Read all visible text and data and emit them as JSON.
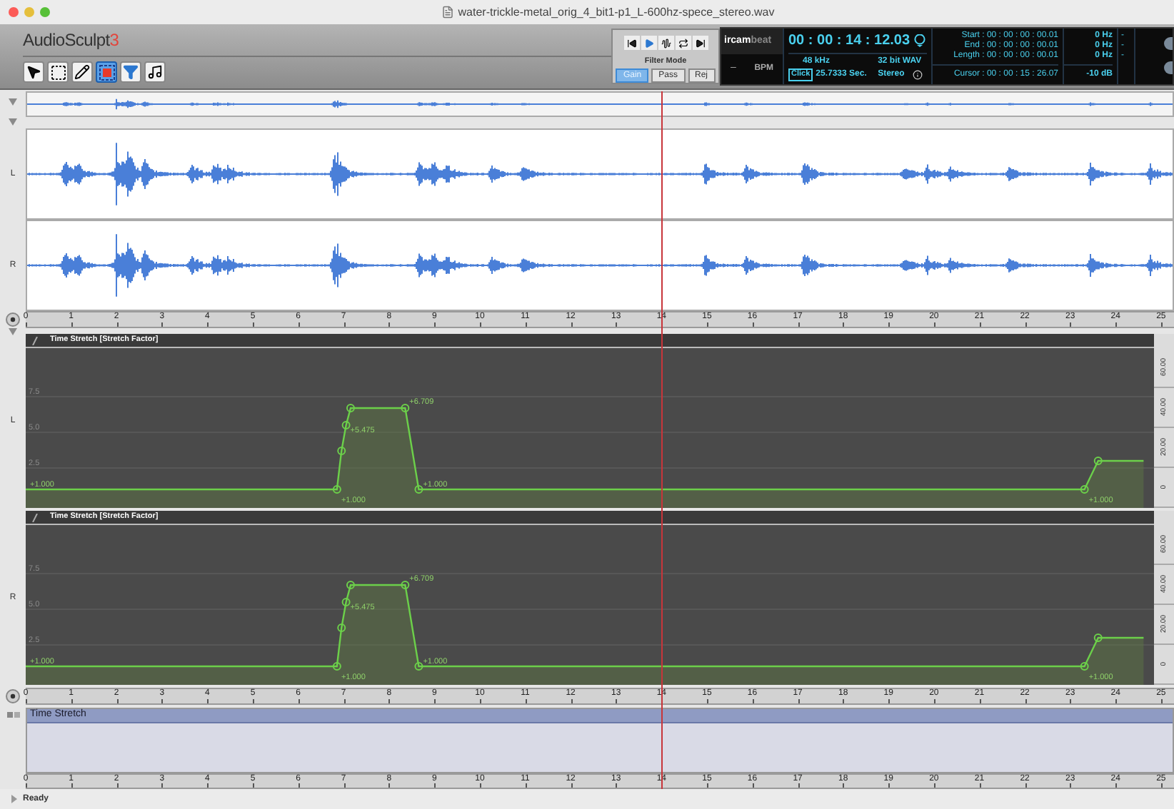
{
  "window": {
    "title": "water-trickle-metal_orig_4_bit1-p1_L-600hz-spece_stereo.wav"
  },
  "app": {
    "name": "AudioSculpt",
    "version": "3"
  },
  "tools": [
    {
      "kind": "pointer",
      "selected": false
    },
    {
      "kind": "marquee",
      "selected": false
    },
    {
      "kind": "pencil",
      "selected": false
    },
    {
      "kind": "region",
      "selected": true
    },
    {
      "kind": "filter",
      "selected": false
    },
    {
      "kind": "note",
      "selected": false
    }
  ],
  "filter": {
    "label": "Filter Mode",
    "modes": [
      {
        "label": "Gain",
        "selected": true
      },
      {
        "label": "Pass",
        "selected": false
      },
      {
        "label": "Rej",
        "selected": false
      }
    ]
  },
  "display": {
    "logo_main": "ircam",
    "logo_sub": "beat",
    "time": "00 : 00 : 14 : 12.03",
    "tempo_value": "–",
    "tempo_label": "BPM",
    "click": "Click",
    "sample_rate": "48 kHz",
    "format": "32 bit WAV",
    "duration": "25.7333 Sec.",
    "channels": "Stereo",
    "positions": [
      "Start : 00 : 00 : 00 : 00.01",
      "End : 00 : 00 : 00 : 00.01",
      "Length : 00 : 00 : 00 : 00.01"
    ],
    "cursor": "Cursor : 00 : 00 : 15 : 26.07",
    "frequencies": [
      "0 Hz",
      "0 Hz",
      "0 Hz"
    ],
    "level": "-10 dB",
    "dashes": [
      "-",
      "-",
      "-"
    ]
  },
  "waveform": {
    "channels": [
      "L",
      "R"
    ]
  },
  "automation": [
    {
      "channel": "L",
      "point_labels": [
        "+1.000",
        "+1.000",
        "+5.475",
        "+6.709",
        "+1.000",
        "+1.000"
      ],
      "scale": [
        "60.00",
        "40.00",
        "20.00",
        "0"
      ],
      "chart_data": {
        "type": "area",
        "title": "Time Stretch [Stretch Factor]",
        "x": [
          0,
          6.85,
          6.95,
          7.05,
          7.15,
          8.35,
          8.65,
          23.3,
          23.6,
          24.6
        ],
        "xlim": [
          0,
          25.27
        ],
        "ylim": [
          -0.3,
          10.9
        ],
        "grid": true,
        "xticks": [
          0,
          1,
          2,
          3,
          4,
          5,
          6,
          7,
          8,
          9,
          10,
          11,
          12,
          13,
          14,
          15,
          16,
          17,
          18,
          19,
          20,
          21,
          22,
          23,
          24,
          25
        ],
        "yticks": [
          {
            "value": 7.5,
            "label": "7.5"
          },
          {
            "value": 5,
            "label": "5.0"
          },
          {
            "value": 2.5,
            "label": "2.5"
          }
        ],
        "series": [
          {
            "color": "#6cd04a",
            "values": [
              1,
              1,
              3.7,
              5.5,
              6.7,
              6.7,
              1,
              1,
              3,
              3
            ]
          }
        ]
      }
    },
    {
      "channel": "R",
      "point_labels": [
        "+1.000",
        "+1.000",
        "+5.475",
        "+6.709",
        "+1.000",
        "+1.000"
      ],
      "scale": [
        "60.00",
        "40.00",
        "20.00",
        "0"
      ],
      "chart_data": {
        "type": "area",
        "title": "Time Stretch [Stretch Factor]",
        "x": [
          0,
          6.85,
          6.95,
          7.05,
          7.15,
          8.35,
          8.65,
          23.3,
          23.6,
          24.6
        ],
        "xlim": [
          0,
          25.27
        ],
        "ylim": [
          -0.3,
          10.9
        ],
        "grid": true,
        "xticks": [
          0,
          1,
          2,
          3,
          4,
          5,
          6,
          7,
          8,
          9,
          10,
          11,
          12,
          13,
          14,
          15,
          16,
          17,
          18,
          19,
          20,
          21,
          22,
          23,
          24,
          25
        ],
        "yticks": [
          {
            "value": 7.5,
            "label": "7.5"
          },
          {
            "value": 5,
            "label": "5.0"
          },
          {
            "value": 2.5,
            "label": "2.5"
          }
        ],
        "series": [
          {
            "color": "#6cd04a",
            "values": [
              1,
              1,
              3.7,
              5.5,
              6.7,
              6.7,
              1,
              1,
              3,
              3
            ]
          }
        ]
      }
    }
  ],
  "track": {
    "title": "Time Stretch",
    "ruler_ticks": [
      "0",
      "1",
      "2",
      "3",
      "4",
      "5",
      "6",
      "7",
      "8",
      "9",
      "10",
      "11",
      "12",
      "13",
      "14",
      "15",
      "16",
      "17",
      "18",
      "19",
      "20",
      "21",
      "22",
      "23",
      "24",
      "25"
    ]
  },
  "status_bar": {
    "text": "Ready"
  }
}
